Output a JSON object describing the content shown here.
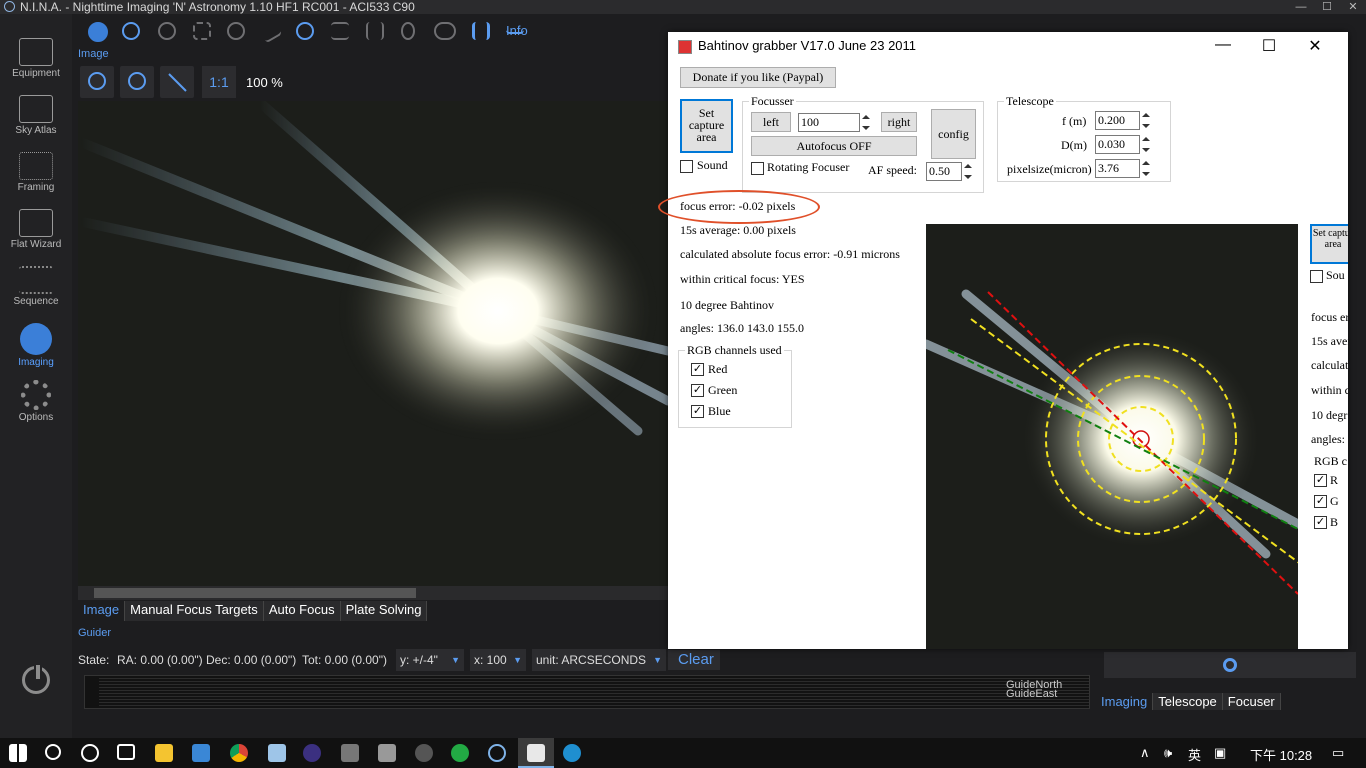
{
  "app": {
    "title": "N.I.N.A. - Nighttime Imaging 'N' Astronomy 1.10 HF1 RC001  -  ACI533 C90",
    "window_controls": [
      "—",
      "☐",
      "✕"
    ]
  },
  "sidebar": {
    "items": [
      {
        "label": "Equipment",
        "icon": "telescope-icon"
      },
      {
        "label": "Sky Atlas",
        "icon": "map-icon"
      },
      {
        "label": "Framing",
        "icon": "framing-icon"
      },
      {
        "label": "Flat Wizard",
        "icon": "flat-wizard-icon"
      },
      {
        "label": "Sequence",
        "icon": "list-icon"
      },
      {
        "label": "Imaging",
        "icon": "aperture-icon",
        "active": true
      },
      {
        "label": "Options",
        "icon": "gear-icon"
      }
    ]
  },
  "toolbar": {
    "info_label": "Info",
    "image_label": "Image"
  },
  "image_tools": {
    "one_to_one": "1:1",
    "zoom": "100 %"
  },
  "bottom_tabs": [
    "Image",
    "Manual Focus Targets",
    "Auto Focus",
    "Plate Solving"
  ],
  "guider": {
    "label": "Guider",
    "state": "State:",
    "ra": "RA: 0.00 (0.00\")",
    "dec": "Dec: 0.00 (0.00\")",
    "tot": "Tot: 0.00 (0.00\")",
    "y_scale": "y: +/-4\"",
    "x_scale": "x: 100",
    "unit": "unit: ARCSECONDS",
    "clear": "Clear",
    "guide_north": "GuideNorth",
    "guide_east": "GuideEast"
  },
  "right_tabs": [
    "Imaging",
    "Telescope",
    "Focuser"
  ],
  "bahtinov": {
    "title": "Bahtinov grabber  V17.0 June 23 2011",
    "donate": "Donate if you like (Paypal)",
    "set_capture": "Set capture area",
    "sound": "Sound",
    "focusser_group": "Focusser",
    "left": "left",
    "right": "right",
    "step": "100",
    "autofocus": "Autofocus OFF",
    "config": "config",
    "rotating": "Rotating Focuser",
    "af_speed_label": "AF speed:",
    "af_speed": "0.50",
    "telescope_group": "Telescope",
    "f_label": "f (m)",
    "f_value": "0.200",
    "d_label": "D(m)",
    "d_value": "0.030",
    "pix_label": "pixelsize(micron)",
    "pix_value": "3.76",
    "focus_error": "focus error: -0.02 pixels",
    "avg": "15s average: 0.00 pixels",
    "abs_error": "calculated absolute focus error: -0.91 microns",
    "critical": "within critical focus: YES",
    "degree": "10 degree Bahtinov",
    "angles": "angles: 136.0 143.0 155.0",
    "rgb_group": "RGB channels used",
    "channels": [
      "Red",
      "Green",
      "Blue"
    ],
    "side_labels": [
      "Set captur area",
      "Sou",
      "focus er",
      "15s avera",
      "calculat",
      "within c",
      "10 degr",
      "angles:",
      "RGB c",
      "R",
      "G",
      "B"
    ]
  },
  "taskbar": {
    "ime": "英",
    "time": "下午 10:28"
  },
  "colors": {
    "accent": "#5b9cf0",
    "annotation": "#e0502a"
  }
}
